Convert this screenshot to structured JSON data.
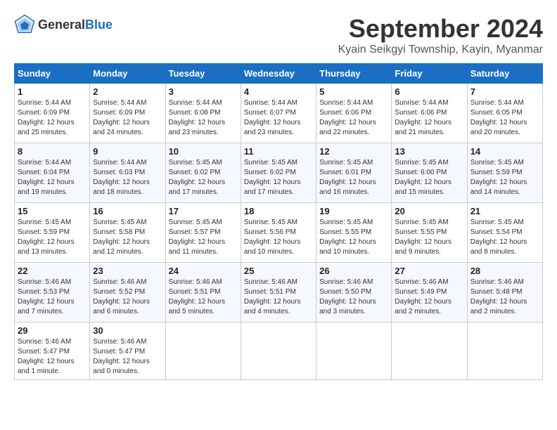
{
  "header": {
    "logo_general": "General",
    "logo_blue": "Blue",
    "month_year": "September 2024",
    "location": "Kyain Seikgyi Township, Kayin, Myanmar"
  },
  "days_of_week": [
    "Sunday",
    "Monday",
    "Tuesday",
    "Wednesday",
    "Thursday",
    "Friday",
    "Saturday"
  ],
  "weeks": [
    [
      {
        "day": "1",
        "sunrise": "5:44 AM",
        "sunset": "6:09 PM",
        "daylight": "12 hours and 25 minutes."
      },
      {
        "day": "2",
        "sunrise": "5:44 AM",
        "sunset": "6:09 PM",
        "daylight": "12 hours and 24 minutes."
      },
      {
        "day": "3",
        "sunrise": "5:44 AM",
        "sunset": "6:08 PM",
        "daylight": "12 hours and 23 minutes."
      },
      {
        "day": "4",
        "sunrise": "5:44 AM",
        "sunset": "6:07 PM",
        "daylight": "12 hours and 23 minutes."
      },
      {
        "day": "5",
        "sunrise": "5:44 AM",
        "sunset": "6:06 PM",
        "daylight": "12 hours and 22 minutes."
      },
      {
        "day": "6",
        "sunrise": "5:44 AM",
        "sunset": "6:06 PM",
        "daylight": "12 hours and 21 minutes."
      },
      {
        "day": "7",
        "sunrise": "5:44 AM",
        "sunset": "6:05 PM",
        "daylight": "12 hours and 20 minutes."
      }
    ],
    [
      {
        "day": "8",
        "sunrise": "5:44 AM",
        "sunset": "6:04 PM",
        "daylight": "12 hours and 19 minutes."
      },
      {
        "day": "9",
        "sunrise": "5:44 AM",
        "sunset": "6:03 PM",
        "daylight": "12 hours and 18 minutes."
      },
      {
        "day": "10",
        "sunrise": "5:45 AM",
        "sunset": "6:02 PM",
        "daylight": "12 hours and 17 minutes."
      },
      {
        "day": "11",
        "sunrise": "5:45 AM",
        "sunset": "6:02 PM",
        "daylight": "12 hours and 17 minutes."
      },
      {
        "day": "12",
        "sunrise": "5:45 AM",
        "sunset": "6:01 PM",
        "daylight": "12 hours and 16 minutes."
      },
      {
        "day": "13",
        "sunrise": "5:45 AM",
        "sunset": "6:00 PM",
        "daylight": "12 hours and 15 minutes."
      },
      {
        "day": "14",
        "sunrise": "5:45 AM",
        "sunset": "5:59 PM",
        "daylight": "12 hours and 14 minutes."
      }
    ],
    [
      {
        "day": "15",
        "sunrise": "5:45 AM",
        "sunset": "5:59 PM",
        "daylight": "12 hours and 13 minutes."
      },
      {
        "day": "16",
        "sunrise": "5:45 AM",
        "sunset": "5:58 PM",
        "daylight": "12 hours and 12 minutes."
      },
      {
        "day": "17",
        "sunrise": "5:45 AM",
        "sunset": "5:57 PM",
        "daylight": "12 hours and 11 minutes."
      },
      {
        "day": "18",
        "sunrise": "5:45 AM",
        "sunset": "5:56 PM",
        "daylight": "12 hours and 10 minutes."
      },
      {
        "day": "19",
        "sunrise": "5:45 AM",
        "sunset": "5:55 PM",
        "daylight": "12 hours and 10 minutes."
      },
      {
        "day": "20",
        "sunrise": "5:45 AM",
        "sunset": "5:55 PM",
        "daylight": "12 hours and 9 minutes."
      },
      {
        "day": "21",
        "sunrise": "5:45 AM",
        "sunset": "5:54 PM",
        "daylight": "12 hours and 8 minutes."
      }
    ],
    [
      {
        "day": "22",
        "sunrise": "5:46 AM",
        "sunset": "5:53 PM",
        "daylight": "12 hours and 7 minutes."
      },
      {
        "day": "23",
        "sunrise": "5:46 AM",
        "sunset": "5:52 PM",
        "daylight": "12 hours and 6 minutes."
      },
      {
        "day": "24",
        "sunrise": "5:46 AM",
        "sunset": "5:51 PM",
        "daylight": "12 hours and 5 minutes."
      },
      {
        "day": "25",
        "sunrise": "5:46 AM",
        "sunset": "5:51 PM",
        "daylight": "12 hours and 4 minutes."
      },
      {
        "day": "26",
        "sunrise": "5:46 AM",
        "sunset": "5:50 PM",
        "daylight": "12 hours and 3 minutes."
      },
      {
        "day": "27",
        "sunrise": "5:46 AM",
        "sunset": "5:49 PM",
        "daylight": "12 hours and 2 minutes."
      },
      {
        "day": "28",
        "sunrise": "5:46 AM",
        "sunset": "5:48 PM",
        "daylight": "12 hours and 2 minutes."
      }
    ],
    [
      {
        "day": "29",
        "sunrise": "5:46 AM",
        "sunset": "5:47 PM",
        "daylight": "12 hours and 1 minute."
      },
      {
        "day": "30",
        "sunrise": "5:46 AM",
        "sunset": "5:47 PM",
        "daylight": "12 hours and 0 minutes."
      },
      null,
      null,
      null,
      null,
      null
    ]
  ],
  "labels": {
    "sunrise_prefix": "Sunrise: ",
    "sunset_prefix": "Sunset: ",
    "daylight_prefix": "Daylight: "
  }
}
